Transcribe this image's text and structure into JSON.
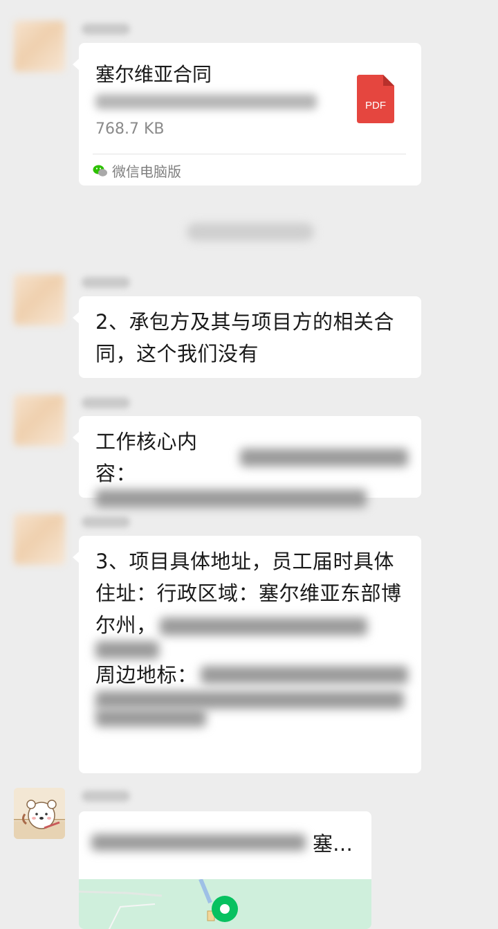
{
  "messages": {
    "file": {
      "title": "塞尔维亚合同",
      "size": "768.7 KB",
      "file_type": "PDF",
      "source": "微信电脑版"
    },
    "msg2": {
      "text": "2、承包方及其与项目方的相关合同，这个我们没有"
    },
    "msg3": {
      "prefix": "工作核心内容："
    },
    "msg4": {
      "line1": "3、项目具体地址，员工届时具体住址：行政区域：塞尔维亚东部博尔州，",
      "landmark_label": "周边地标："
    },
    "location": {
      "title_suffix": "塞…"
    }
  },
  "colors": {
    "background": "#ededed",
    "bubble": "#ffffff",
    "pdf_red": "#e5463f",
    "wechat_green": "#07c160",
    "map_green": "#ccefd9"
  },
  "icons": {
    "file_icon": "pdf-file-icon",
    "source_icon": "wechat-logo-icon",
    "map_pin": "location-pin-icon"
  }
}
